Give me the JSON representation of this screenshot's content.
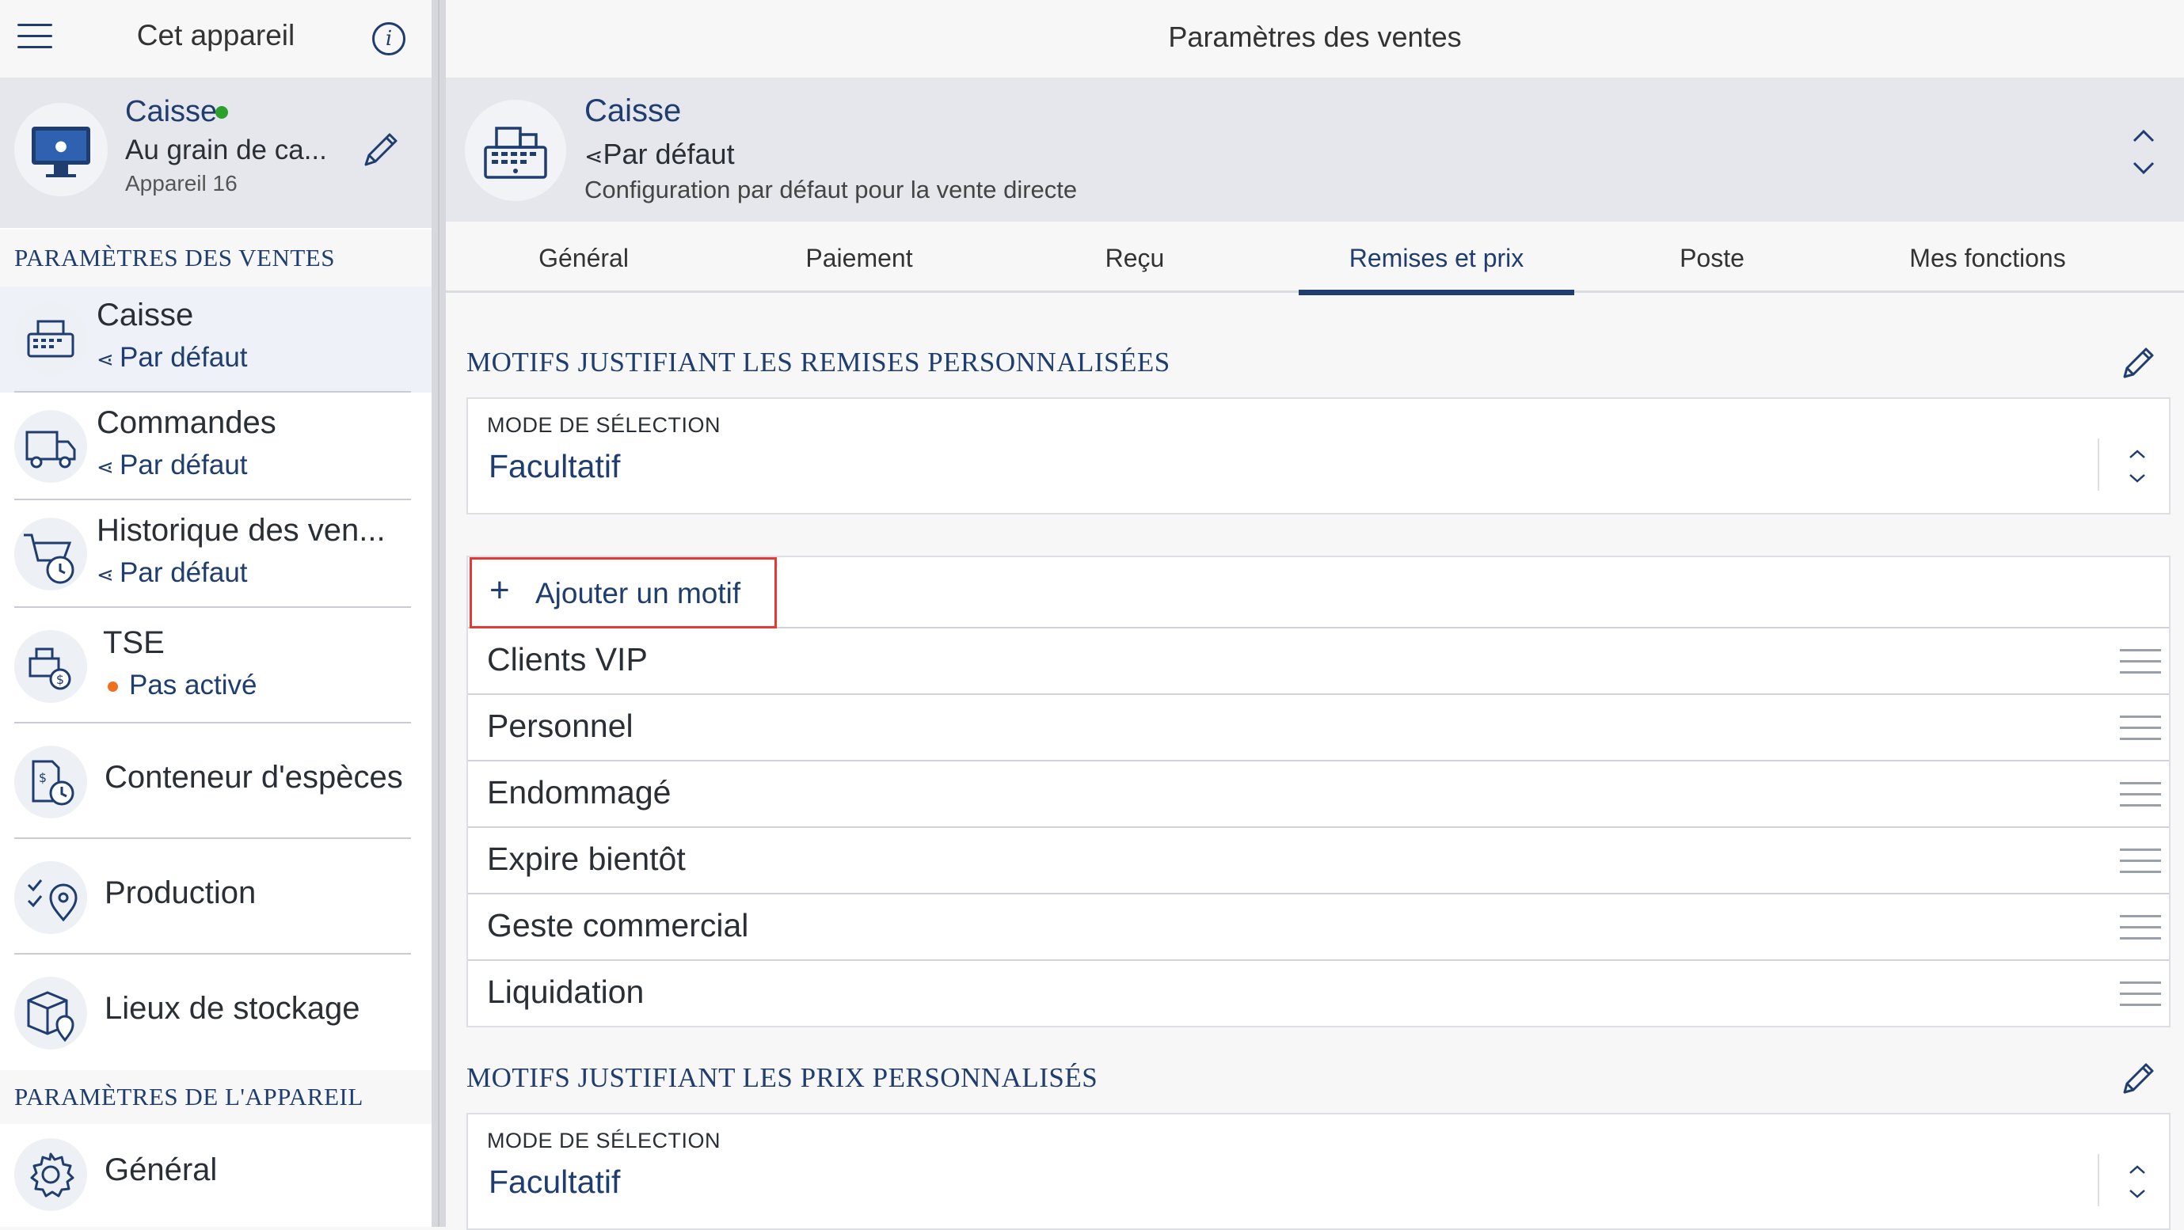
{
  "sidebar": {
    "title": "Cet appareil",
    "device": {
      "name": "Caisse",
      "subtitle": "Au grain de ca...",
      "meta": "Appareil 16",
      "status_color": "#2ca02c"
    },
    "sales_section": "PARAMÈTRES DES VENTES",
    "items": [
      {
        "label": "Caisse",
        "sub": "Par défaut"
      },
      {
        "label": "Commandes",
        "sub": "Par défaut"
      },
      {
        "label": "Historique des ven...",
        "sub": "Par défaut"
      },
      {
        "label": "TSE",
        "sub": "Pas activé",
        "status_color": "#f07020"
      },
      {
        "label": "Conteneur d'espèces"
      },
      {
        "label": "Production"
      },
      {
        "label": "Lieux de stockage"
      }
    ],
    "device_section": "PARAMÈTRES DE L'APPAREIL",
    "device_items": [
      {
        "label": "Général"
      }
    ]
  },
  "main": {
    "title": "Paramètres des ventes",
    "config": {
      "name": "Caisse",
      "mode": "Par défaut",
      "description": "Configuration par défaut pour la vente directe"
    },
    "tabs": [
      {
        "label": "Général"
      },
      {
        "label": "Paiement"
      },
      {
        "label": "Reçu"
      },
      {
        "label": "Remises et prix",
        "active": true
      },
      {
        "label": "Poste"
      },
      {
        "label": "Mes fonctions"
      }
    ],
    "discount_section": {
      "title": "MOTIFS JUSTIFIANT LES REMISES PERSONNALISÉES",
      "select_label": "MODE DE SÉLECTION",
      "select_value": "Facultatif",
      "add_label": "Ajouter un motif",
      "reasons": [
        "Clients VIP",
        "Personnel",
        "Endommagé",
        "Expire bientôt",
        "Geste commercial",
        "Liquidation"
      ]
    },
    "price_section": {
      "title": "MOTIFS JUSTIFIANT LES PRIX PERSONNALISÉS",
      "select_label": "MODE DE SÉLECTION",
      "select_value": "Facultatif"
    }
  },
  "colors": {
    "accent": "#1f3d6e",
    "highlight_border": "#e53935"
  }
}
